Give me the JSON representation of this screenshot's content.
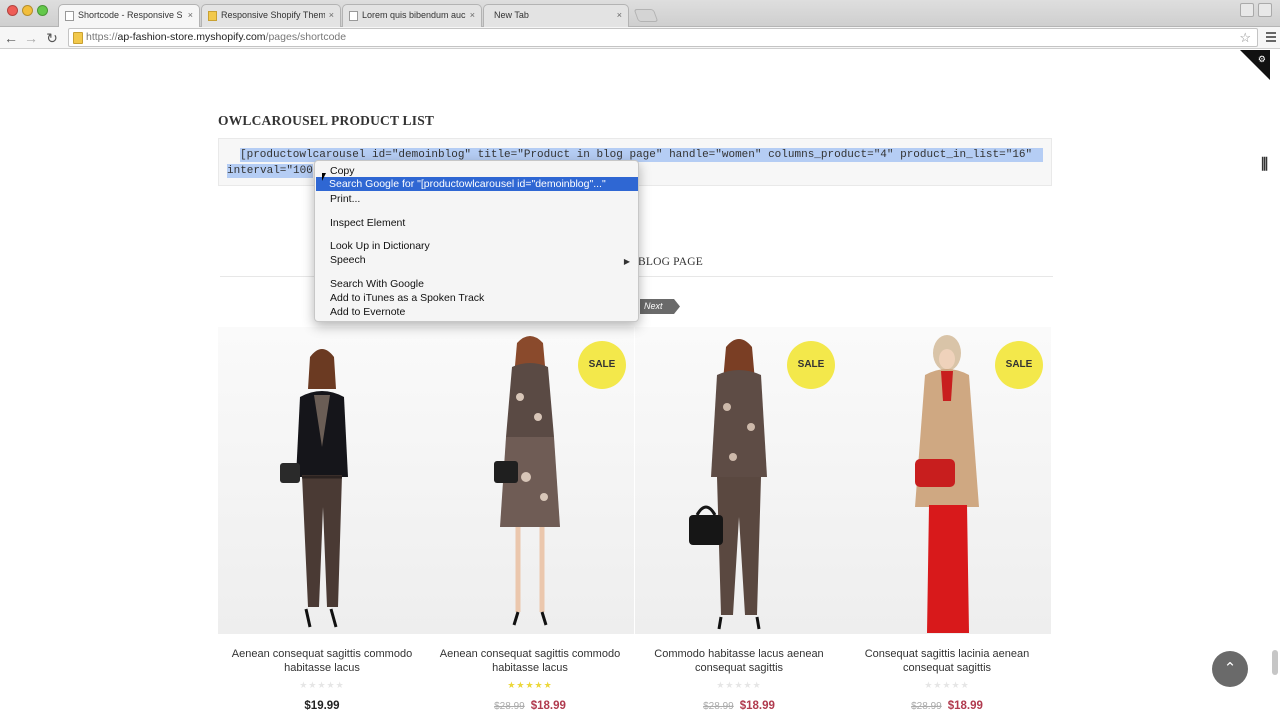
{
  "browser": {
    "tabs": [
      {
        "title": "Shortcode - Responsive Sh",
        "active": true
      },
      {
        "title": "Responsive Shopify Them",
        "active": false
      },
      {
        "title": "Lorem quis bibendum auc",
        "active": false
      },
      {
        "title": "New Tab",
        "active": false
      }
    ],
    "tab_close": "×",
    "url_prefix": "https://",
    "url_domain": "ap-fashion-store.myshopify.com",
    "url_path": "/pages/shortcode",
    "nav": {
      "back": "←",
      "forward": "→",
      "reload": "↻",
      "star": "☆"
    }
  },
  "page": {
    "section_title": "OWLCAROUSEL PRODUCT LIST",
    "code_line1": "[productowlcarousel id=\"demoinblog\" title=\"Product in blog page\" handle=\"women\" columns_product=\"4\" product_in_list=\"16\"",
    "code_line2": "interval=\"100",
    "blog_heading": "BLOG PAGE",
    "next_label": "Next",
    "sale_label": "SALE",
    "products": [
      {
        "name": "Aenean consequat sagittis commodo habitasse lacus",
        "price": "$19.99",
        "sale": false,
        "rated": false
      },
      {
        "name": "Aenean consequat sagittis commodo habitasse lacus",
        "old_price": "$28.99",
        "price": "$18.99",
        "sale": true,
        "rated": true
      },
      {
        "name": "Commodo habitasse lacus aenean consequat sagittis",
        "old_price": "$28.99",
        "price": "$18.99",
        "sale": true,
        "rated": false
      },
      {
        "name": "Consequat sagittis lacinia aenean consequat sagittis",
        "old_price": "$28.99",
        "price": "$18.99",
        "sale": true,
        "rated": false
      }
    ],
    "stars": "★★★★★",
    "back_to_top": "⌃"
  },
  "context_menu": {
    "copy": "Copy",
    "search_google_for": "Search Google for \"[productowlcarousel id=\"demoinblog\"...\"",
    "print": "Print...",
    "inspect": "Inspect Element",
    "look_up": "Look Up in Dictionary",
    "speech": "Speech",
    "search_with_google": "Search With Google",
    "add_itunes": "Add to iTunes as a Spoken Track",
    "add_evernote": "Add to Evernote",
    "submenu_arrow": "▶"
  },
  "colors": {
    "sale_badge": "#f3e84b",
    "sale_price": "#b03a4e",
    "highlight": "#2f67d3",
    "selection": "#b5cdf4"
  }
}
